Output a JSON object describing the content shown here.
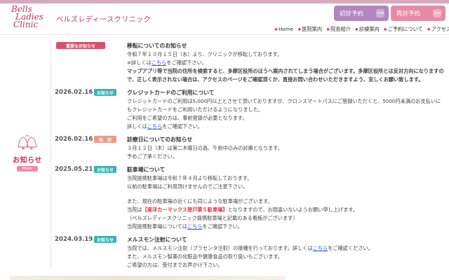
{
  "header": {
    "logo_lines": [
      "Bells",
      "Ladies",
      "Clinic"
    ],
    "clinic_name": "ベルズレディースクリニック",
    "first_visit_label": "初診予約",
    "repeat_visit_label": "再診予約",
    "button_dots": "•••"
  },
  "nav": {
    "items": [
      "Home",
      "医院案内",
      "院長紹介",
      "診療案内",
      "ご予約について",
      "アクセス"
    ]
  },
  "sidebar": {
    "title": "お知らせ",
    "more_label": "More"
  },
  "news": [
    {
      "badge": "重要なお知らせ",
      "title": "移転についてのお知らせ",
      "l1": "令和７年１０月１５日（水）より、クリニックが移転しております。",
      "l2a": "※詳しくは",
      "link": "こちら",
      "l2b": "をご確認下さい。",
      "warn": "マップアプリ等で当院の住所を検索すると、多摩区役所のほうへ案内されてしまう場合がございます。多摩区役所とは反対方向になりますので、正しく表示されない場合は、アクセスのページをご確認頂くか、直接お問い合わせいただきますよう、宜しくお願い致します。"
    },
    {
      "date": "2026.02.16",
      "badge": "お知らせ",
      "title": "クレジットカードのご利用について",
      "l1": "クレジットカードのご利用は5,000円以上とさせて頂いておりますが、クロンスマートパスにご登録いただくと、5000円未満のお支払いにもクレジットカードをご利用いただけるようになりました。",
      "l2": "ご利用をご希望の方は、事前登録が必要となります。",
      "l3a": "詳しくは",
      "link": "こちら",
      "l3b": "をご確認下さい。"
    },
    {
      "date": "2026.02.16",
      "badge": "休　診",
      "title": "診療日についてのお知らせ",
      "l1": "３月１２日（木）は第二木曜日の為、午前中のみの診療となります。",
      "l2": "予めご了承ください。"
    },
    {
      "date": "2025.05.21",
      "badge": "お知らせ",
      "title": "駐車場について",
      "l1": "当院提携駐車場は令和７年４月より移転しております。",
      "l2": "以前の駐車場はご利用頂けませんのでご注意下さい。",
      "l3": "また、現在の駐車場の近くにも同じような駐車場がございます。",
      "l4a": "当院は",
      "l4red": "【東洋カーマックス登戸第５駐車場】",
      "l4b": "となりますので、お間違いないようお願い申し上げます。",
      "l5": "（ベルズレディースクリニック提携駐車場と記載のある看板がございます）",
      "l6a": "当院提携駐車場については",
      "link": "こちら",
      "l6b": "をご確認下さい。"
    },
    {
      "date": "2024.03.19",
      "badge": "お知らせ",
      "title": "メルスモン注射について",
      "l1a": "当院では、メルスモン注射（プラセンタ注射）の接種を行っております。詳しくは",
      "link": "こちら",
      "l1b": "をご確認ください。",
      "l2": "また、メルスモン製薬の化粧品や健康食品の取り扱いもございます。",
      "l3": "ご希望の方は、受付までお声かけ下さい。"
    }
  ],
  "colors": {
    "brand": "#c5305c",
    "important": "#d94f6b",
    "info": "#3cb3b6",
    "closed": "#ef9a86",
    "warning_text": "#e0313c"
  }
}
